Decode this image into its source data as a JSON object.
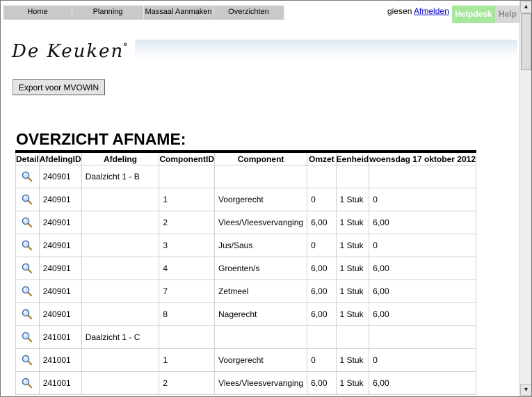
{
  "nav": {
    "items": [
      "Home",
      "Planning",
      "Massaal Aanmaken",
      "Overzichten"
    ]
  },
  "user": {
    "name": "giesen",
    "logout": "Afmelden"
  },
  "help": {
    "helpdesk": "Helpdesk",
    "help": "Help"
  },
  "logo": {
    "text": "De Keuken",
    "mark": "e"
  },
  "export_button": "Export voor MVOWIN",
  "title": "OVERZICHT AFNAME:",
  "table": {
    "columns": [
      "Detail",
      "AfdelingID",
      "Afdeling",
      "ComponentID",
      "Component",
      "Omzet",
      "Eenheid",
      "woensdag 17 oktober 2012"
    ],
    "rows": [
      {
        "afdelingid": "240901",
        "afdeling": "Daalzicht 1 - B",
        "componentid": "",
        "component": "",
        "omzet": "",
        "eenheid": "",
        "dag": ""
      },
      {
        "afdelingid": "240901",
        "afdeling": "",
        "componentid": "1",
        "component": "Voorgerecht",
        "omzet": "0",
        "eenheid": "1 Stuk",
        "dag": "0"
      },
      {
        "afdelingid": "240901",
        "afdeling": "",
        "componentid": "2",
        "component": "Vlees/Vleesvervanging",
        "omzet": "6,00",
        "eenheid": "1 Stuk",
        "dag": "6,00"
      },
      {
        "afdelingid": "240901",
        "afdeling": "",
        "componentid": "3",
        "component": "Jus/Saus",
        "omzet": "0",
        "eenheid": "1 Stuk",
        "dag": "0"
      },
      {
        "afdelingid": "240901",
        "afdeling": "",
        "componentid": "4",
        "component": "Groenten/s",
        "omzet": "6,00",
        "eenheid": "1 Stuk",
        "dag": "6,00"
      },
      {
        "afdelingid": "240901",
        "afdeling": "",
        "componentid": "7",
        "component": "Zetmeel",
        "omzet": "6,00",
        "eenheid": "1 Stuk",
        "dag": "6,00"
      },
      {
        "afdelingid": "240901",
        "afdeling": "",
        "componentid": "8",
        "component": "Nagerecht",
        "omzet": "6,00",
        "eenheid": "1 Stuk",
        "dag": "6,00"
      },
      {
        "afdelingid": "241001",
        "afdeling": "Daalzicht 1 - C",
        "componentid": "",
        "component": "",
        "omzet": "",
        "eenheid": "",
        "dag": ""
      },
      {
        "afdelingid": "241001",
        "afdeling": "",
        "componentid": "1",
        "component": "Voorgerecht",
        "omzet": "0",
        "eenheid": "1 Stuk",
        "dag": "0"
      },
      {
        "afdelingid": "241001",
        "afdeling": "",
        "componentid": "2",
        "component": "Vlees/Vleesvervanging",
        "omzet": "6,00",
        "eenheid": "1 Stuk",
        "dag": "6,00"
      }
    ]
  },
  "colors": {
    "helpdesk_bg": "#a6e79c",
    "nav_bg": "#c9c9c9",
    "link": "#0000cc"
  },
  "icons": {
    "detail": "magnifier-icon",
    "scroll_up": "arrow-up-icon",
    "scroll_down": "arrow-down-icon"
  }
}
